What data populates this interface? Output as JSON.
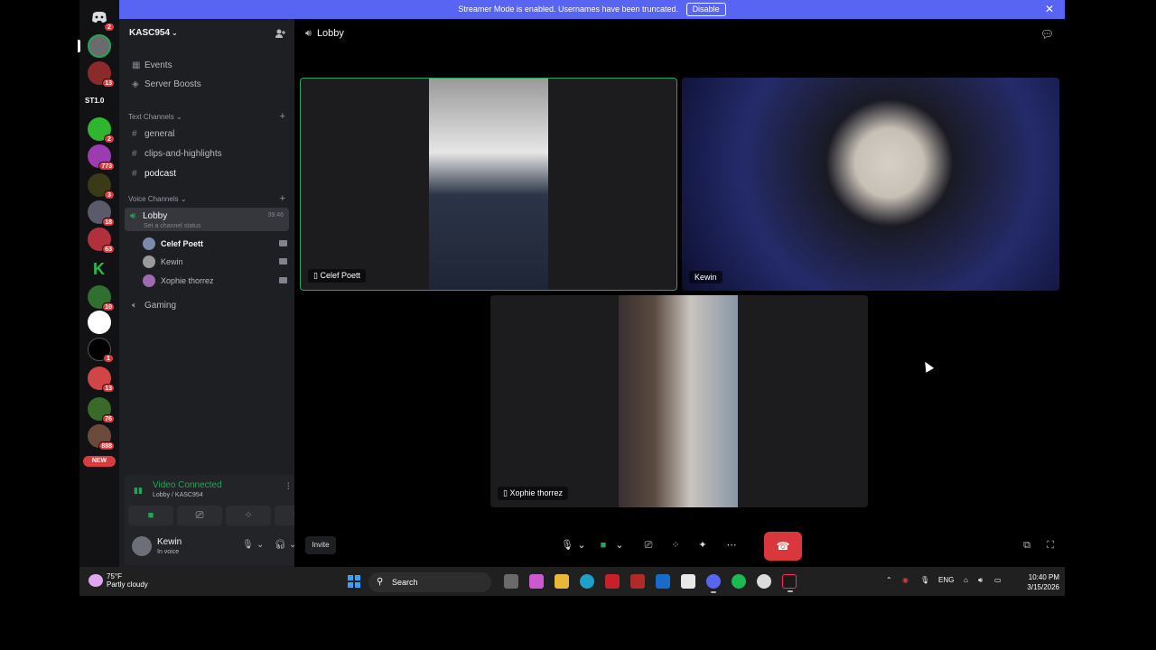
{
  "banner": {
    "text": "Streamer Mode is enabled. Usernames have been truncated.",
    "disable_label": "Disable"
  },
  "rail": {
    "servers": [
      {
        "name": "home-discord-icon",
        "color": "#5865f2",
        "badge": "2"
      },
      {
        "name": "server-avatar-1",
        "color": "#6b6b6b",
        "badge": ""
      },
      {
        "name": "server-avatar-2",
        "color": "#8b2a2a",
        "badge": "13"
      },
      {
        "name": "server-st10",
        "color": "#121214",
        "badge": "",
        "text": "ST1.0"
      },
      {
        "name": "server-m",
        "color": "#2fb52f",
        "badge": "2"
      },
      {
        "name": "server-4",
        "color": "#9b3db0",
        "badge": "773"
      },
      {
        "name": "server-5",
        "color": "#3a3a18",
        "badge": "3"
      },
      {
        "name": "server-6",
        "color": "#5a5a6a",
        "badge": "18"
      },
      {
        "name": "server-7",
        "color": "#b0303c",
        "badge": "63"
      },
      {
        "name": "server-k",
        "color": "#1dc24a",
        "badge": ""
      },
      {
        "name": "server-8",
        "color": "#2f6f2f",
        "badge": "10"
      },
      {
        "name": "server-swy",
        "color": "#ffffff",
        "badge": ""
      },
      {
        "name": "server-dollar",
        "color": "#000000",
        "badge": "1"
      },
      {
        "name": "server-9",
        "color": "#d04545",
        "badge": "13"
      },
      {
        "name": "server-10",
        "color": "#3a6a2a",
        "badge": "76"
      },
      {
        "name": "server-11",
        "color": "#6a4a3a",
        "badge": "888"
      }
    ],
    "new_label": "NEW"
  },
  "sidebar": {
    "server_name": "KASC954",
    "top_items": [
      {
        "label": "Events"
      },
      {
        "label": "Server Boosts"
      }
    ],
    "text_category": "Text Channels",
    "text_channels": [
      {
        "label": "general"
      },
      {
        "label": "clips-and-highlights"
      },
      {
        "label": "podcast"
      }
    ],
    "voice_category": "Voice Channels",
    "lobby": {
      "label": "Lobby",
      "status": "Set a channel status",
      "timer": "39:46"
    },
    "voice_users": [
      {
        "label": "Celef Poett",
        "color": "#7a8aa8"
      },
      {
        "label": "Kewin",
        "color": "#9a9a9a"
      },
      {
        "label": "Xophie thorrez",
        "color": "#a06ab0"
      }
    ],
    "gaming": "Gaming"
  },
  "voice_panel": {
    "title": "Video Connected",
    "subtitle": "Lobby / KASC954"
  },
  "user_panel": {
    "name": "Kewin",
    "status": "In voice"
  },
  "main": {
    "title": "Lobby",
    "tiles": [
      {
        "label": "Celef Poett"
      },
      {
        "label": "Kewin"
      },
      {
        "label": "Xophie thorrez"
      }
    ],
    "invite_label": "Invite"
  },
  "taskbar": {
    "weather_temp": "75°F",
    "weather_cond": "Partly cloudy",
    "search_label": "Search",
    "lang": "ENG",
    "time": "10:40 PM",
    "date": "3/15/2026"
  }
}
